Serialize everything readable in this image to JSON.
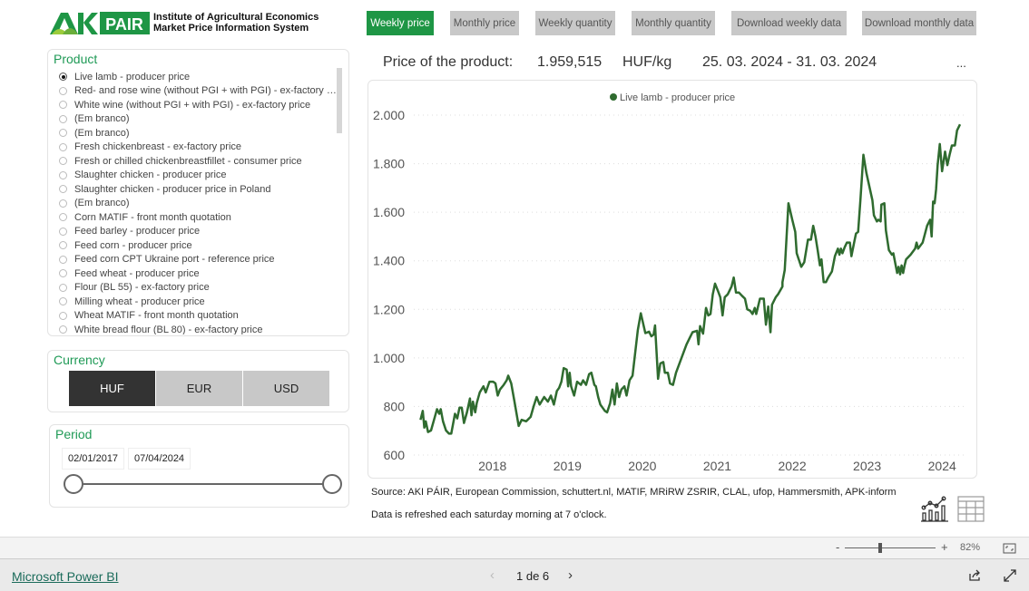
{
  "header": {
    "logo_text": "AKI PÁIR",
    "org_line1": "Institute of Agricultural Economics",
    "org_line2": "Market Price Information System"
  },
  "nav": [
    {
      "label": "Weekly price",
      "active": true
    },
    {
      "label": "Monthly price",
      "active": false
    },
    {
      "label": "Weekly quantity",
      "active": false
    },
    {
      "label": "Monthly quantity",
      "active": false
    },
    {
      "label": "Download weekly data",
      "active": false
    },
    {
      "label": "Download monthly data",
      "active": false
    }
  ],
  "product": {
    "title": "Product",
    "selected": 0,
    "items": [
      "Live lamb - producer price",
      "Red- and rose wine (without PGI + with PGI) - ex-factory price",
      "White wine (without PGI + with PGI) - ex-factory price",
      "(Em branco)",
      "(Em branco)",
      "Fresh chickenbreast - ex-factory price",
      "Fresh or chilled chickenbreastfillet - consumer price",
      "Slaughter chicken - producer price",
      "Slaughter chicken - producer price in Poland",
      "(Em branco)",
      "Corn MATIF - front month quotation",
      "Feed barley - producer price",
      "Feed corn - producer price",
      "Feed corn CPT Ukraine port - reference price",
      "Feed wheat - producer price",
      "Flour (BL 55) - ex-factory price",
      "Milling wheat - producer price",
      "Wheat MATIF - front month quotation",
      "White bread flour (BL 80) - ex-factory price"
    ]
  },
  "currency": {
    "title": "Currency",
    "options": [
      "HUF",
      "EUR",
      "USD"
    ],
    "selected": "HUF"
  },
  "period": {
    "title": "Period",
    "start": "02/01/2017",
    "end": "07/04/2024"
  },
  "price": {
    "label": "Price of the product:",
    "value": "1.959,515",
    "unit": "HUF/kg",
    "range": "25. 03. 2024 - 31. 03. 2024",
    "more": "..."
  },
  "source": "Source: AKI PÁIR, European Commission, schuttert.nl, MATIF, MRiRW ZSRIR, CLAL, ufop, Hammersmith, APK-inform",
  "refresh": "Data is refreshed each saturday morning at 7 o'clock.",
  "zoom": {
    "minus": "-",
    "plus": "+",
    "level": "82%"
  },
  "footer": {
    "link": "Microsoft Power BI",
    "page": "1 de 6"
  },
  "colors": {
    "accent": "#1e9645",
    "line": "#2f6b2f"
  },
  "chart_data": {
    "type": "line",
    "legend": [
      "Live lamb - producer price"
    ],
    "legend_placement": "top-center",
    "grid": true,
    "ylim": [
      600,
      2000
    ],
    "yticks": [
      600,
      800,
      1000,
      1200,
      1400,
      1600,
      1800,
      2000
    ],
    "ytick_labels": [
      "600",
      "800",
      "1.000",
      "1.200",
      "1.400",
      "1.600",
      "1.800",
      "2.000"
    ],
    "xticks": [
      "2018",
      "2019",
      "2020",
      "2021",
      "2022",
      "2023",
      "2024"
    ],
    "xlim": [
      2016.95,
      2024.3
    ],
    "series": [
      {
        "name": "Live lamb - producer price",
        "points": [
          [
            2017.04,
            745
          ],
          [
            2017.07,
            782
          ],
          [
            2017.09,
            713
          ],
          [
            2017.11,
            739
          ],
          [
            2017.14,
            695
          ],
          [
            2017.18,
            701
          ],
          [
            2017.22,
            745
          ],
          [
            2017.26,
            789
          ],
          [
            2017.29,
            770
          ],
          [
            2017.31,
            789
          ],
          [
            2017.34,
            739
          ],
          [
            2017.38,
            701
          ],
          [
            2017.42,
            688
          ],
          [
            2017.45,
            688
          ],
          [
            2017.5,
            770
          ],
          [
            2017.53,
            751
          ],
          [
            2017.56,
            795
          ],
          [
            2017.59,
            795
          ],
          [
            2017.62,
            732
          ],
          [
            2017.66,
            776
          ],
          [
            2017.7,
            833
          ],
          [
            2017.72,
            764
          ],
          [
            2017.74,
            820
          ],
          [
            2017.77,
            776
          ],
          [
            2017.79,
            814
          ],
          [
            2017.83,
            858
          ],
          [
            2017.88,
            883
          ],
          [
            2017.91,
            858
          ],
          [
            2017.96,
            902
          ],
          [
            2018.01,
            902
          ],
          [
            2018.04,
            895
          ],
          [
            2018.07,
            845
          ],
          [
            2018.1,
            870
          ],
          [
            2018.15,
            889
          ],
          [
            2018.19,
            908
          ],
          [
            2018.21,
            927
          ],
          [
            2018.25,
            895
          ],
          [
            2018.29,
            826
          ],
          [
            2018.35,
            720
          ],
          [
            2018.39,
            745
          ],
          [
            2018.45,
            739
          ],
          [
            2018.51,
            757
          ],
          [
            2018.55,
            801
          ],
          [
            2018.59,
            839
          ],
          [
            2018.63,
            808
          ],
          [
            2018.69,
            839
          ],
          [
            2018.74,
            820
          ],
          [
            2018.78,
            845
          ],
          [
            2018.82,
            808
          ],
          [
            2018.86,
            864
          ],
          [
            2018.89,
            877
          ],
          [
            2018.92,
            902
          ],
          [
            2018.95,
            958
          ],
          [
            2018.99,
            952
          ],
          [
            2019.01,
            883
          ],
          [
            2019.03,
            939
          ],
          [
            2019.05,
            883
          ],
          [
            2019.09,
            845
          ],
          [
            2019.13,
            902
          ],
          [
            2019.18,
            889
          ],
          [
            2019.21,
            908
          ],
          [
            2019.25,
            889
          ],
          [
            2019.29,
            933
          ],
          [
            2019.32,
            939
          ],
          [
            2019.36,
            889
          ],
          [
            2019.38,
            883
          ],
          [
            2019.41,
            839
          ],
          [
            2019.44,
            808
          ],
          [
            2019.5,
            782
          ],
          [
            2019.53,
            776
          ],
          [
            2019.57,
            814
          ],
          [
            2019.6,
            870
          ],
          [
            2019.63,
            808
          ],
          [
            2019.66,
            895
          ],
          [
            2019.69,
            839
          ],
          [
            2019.72,
            870
          ],
          [
            2019.76,
            883
          ],
          [
            2019.79,
            845
          ],
          [
            2019.83,
            908
          ],
          [
            2019.87,
            927
          ],
          [
            2019.94,
            1115
          ],
          [
            2019.98,
            1184
          ],
          [
            2020.04,
            1102
          ],
          [
            2020.09,
            1108
          ],
          [
            2020.12,
            1089
          ],
          [
            2020.15,
            1096
          ],
          [
            2020.17,
            1134
          ],
          [
            2020.21,
            914
          ],
          [
            2020.24,
            977
          ],
          [
            2020.28,
            983
          ],
          [
            2020.3,
            939
          ],
          [
            2020.34,
            939
          ],
          [
            2020.37,
            895
          ],
          [
            2020.41,
            889
          ],
          [
            2020.45,
            939
          ],
          [
            2020.59,
            1056
          ],
          [
            2020.63,
            1081
          ],
          [
            2020.67,
            1106
          ],
          [
            2020.73,
            1112
          ],
          [
            2020.75,
            1056
          ],
          [
            2020.77,
            1131
          ],
          [
            2020.81,
            1100
          ],
          [
            2020.85,
            1206
          ],
          [
            2020.88,
            1175
          ],
          [
            2020.91,
            1181
          ],
          [
            2020.94,
            1262
          ],
          [
            2020.97,
            1306
          ],
          [
            2021.01,
            1275
          ],
          [
            2021.04,
            1250
          ],
          [
            2021.07,
            1175
          ],
          [
            2021.1,
            1250
          ],
          [
            2021.14,
            1262
          ],
          [
            2021.16,
            1275
          ],
          [
            2021.19,
            1294
          ],
          [
            2021.22,
            1331
          ],
          [
            2021.25,
            1269
          ],
          [
            2021.29,
            1269
          ],
          [
            2021.33,
            1256
          ],
          [
            2021.37,
            1244
          ],
          [
            2021.4,
            1200
          ],
          [
            2021.44,
            1194
          ],
          [
            2021.47,
            1181
          ],
          [
            2021.5,
            1206
          ],
          [
            2021.52,
            1181
          ],
          [
            2021.57,
            1244
          ],
          [
            2021.62,
            1244
          ],
          [
            2021.65,
            1137
          ],
          [
            2021.68,
            1212
          ],
          [
            2021.71,
            1106
          ],
          [
            2021.73,
            1219
          ],
          [
            2021.78,
            1250
          ],
          [
            2021.81,
            1262
          ],
          [
            2021.87,
            1294
          ],
          [
            2021.87,
            1312
          ],
          [
            2021.9,
            1362
          ],
          [
            2021.95,
            1637
          ],
          [
            2022.0,
            1569
          ],
          [
            2022.04,
            1519
          ],
          [
            2022.06,
            1431
          ],
          [
            2022.12,
            1375
          ],
          [
            2022.16,
            1394
          ],
          [
            2022.21,
            1487
          ],
          [
            2022.25,
            1487
          ],
          [
            2022.28,
            1544
          ],
          [
            2022.31,
            1500
          ],
          [
            2022.34,
            1444
          ],
          [
            2022.37,
            1381
          ],
          [
            2022.39,
            1406
          ],
          [
            2022.42,
            1312
          ],
          [
            2022.45,
            1312
          ],
          [
            2022.48,
            1331
          ],
          [
            2022.53,
            1356
          ],
          [
            2022.57,
            1419
          ],
          [
            2022.61,
            1450
          ],
          [
            2022.63,
            1425
          ],
          [
            2022.65,
            1450
          ],
          [
            2022.67,
            1431
          ],
          [
            2022.7,
            1456
          ],
          [
            2022.73,
            1475
          ],
          [
            2022.77,
            1475
          ],
          [
            2022.79,
            1419
          ],
          [
            2022.83,
            1481
          ],
          [
            2022.85,
            1512
          ],
          [
            2022.88,
            1519
          ],
          [
            2022.91,
            1650
          ],
          [
            2022.95,
            1837
          ],
          [
            2022.99,
            1762
          ],
          [
            2023.07,
            1650
          ],
          [
            2023.09,
            1587
          ],
          [
            2023.13,
            1562
          ],
          [
            2023.15,
            1569
          ],
          [
            2023.18,
            1562
          ],
          [
            2023.19,
            1631
          ],
          [
            2023.23,
            1637
          ],
          [
            2023.25,
            1525
          ],
          [
            2023.29,
            1444
          ],
          [
            2023.33,
            1425
          ],
          [
            2023.35,
            1431
          ],
          [
            2023.4,
            1350
          ],
          [
            2023.42,
            1375
          ],
          [
            2023.44,
            1344
          ],
          [
            2023.46,
            1381
          ],
          [
            2023.48,
            1350
          ],
          [
            2023.5,
            1381
          ],
          [
            2023.52,
            1406
          ],
          [
            2023.58,
            1425
          ],
          [
            2023.64,
            1450
          ],
          [
            2023.66,
            1475
          ],
          [
            2023.68,
            1450
          ],
          [
            2023.74,
            1475
          ],
          [
            2023.8,
            1544
          ],
          [
            2023.84,
            1569
          ],
          [
            2023.86,
            1500
          ],
          [
            2023.88,
            1644
          ],
          [
            2023.9,
            1637
          ],
          [
            2023.92,
            1694
          ],
          [
            2023.94,
            1794
          ],
          [
            2023.97,
            1881
          ],
          [
            2024.0,
            1769
          ],
          [
            2024.04,
            1850
          ],
          [
            2024.07,
            1794
          ],
          [
            2024.1,
            1837
          ],
          [
            2024.13,
            1875
          ],
          [
            2024.17,
            1875
          ],
          [
            2024.2,
            1937
          ],
          [
            2024.24,
            1962
          ]
        ]
      }
    ]
  }
}
